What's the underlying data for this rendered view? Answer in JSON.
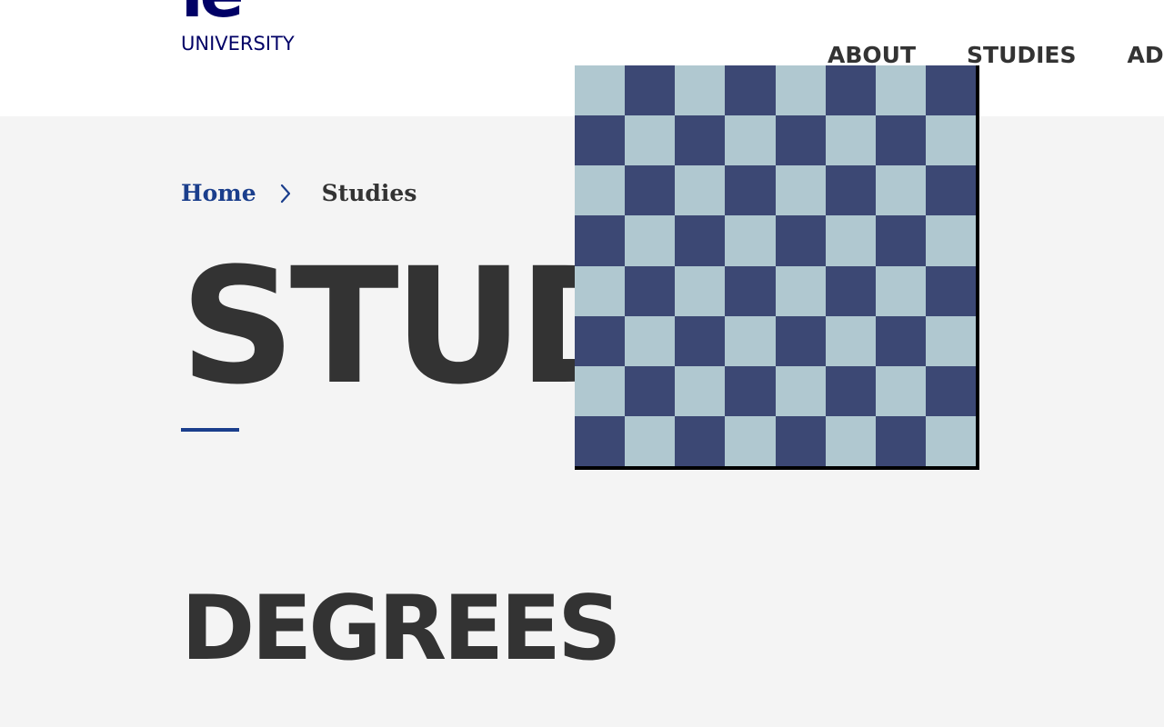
{
  "header": {
    "logo": {
      "mark": "ie",
      "wordmark": "UNIVERSITY",
      "color": "#000066"
    },
    "nav": [
      {
        "label": "ABOUT"
      },
      {
        "label": "STUDIES"
      },
      {
        "label": "AD"
      }
    ]
  },
  "breadcrumb": {
    "home": "Home",
    "separator_icon": "chevron-right-icon",
    "current": "Studies"
  },
  "main": {
    "title": "STUD",
    "section_title": "DEGREES"
  },
  "overlay": {
    "pattern": "checkerboard",
    "grid": 8,
    "colors": {
      "light": "#b0c8d0",
      "dark": "#3c4874"
    }
  },
  "colors": {
    "accent": "#1a3e8c",
    "text": "#333333",
    "background": "#f4f4f4",
    "header_background": "#ffffff"
  }
}
